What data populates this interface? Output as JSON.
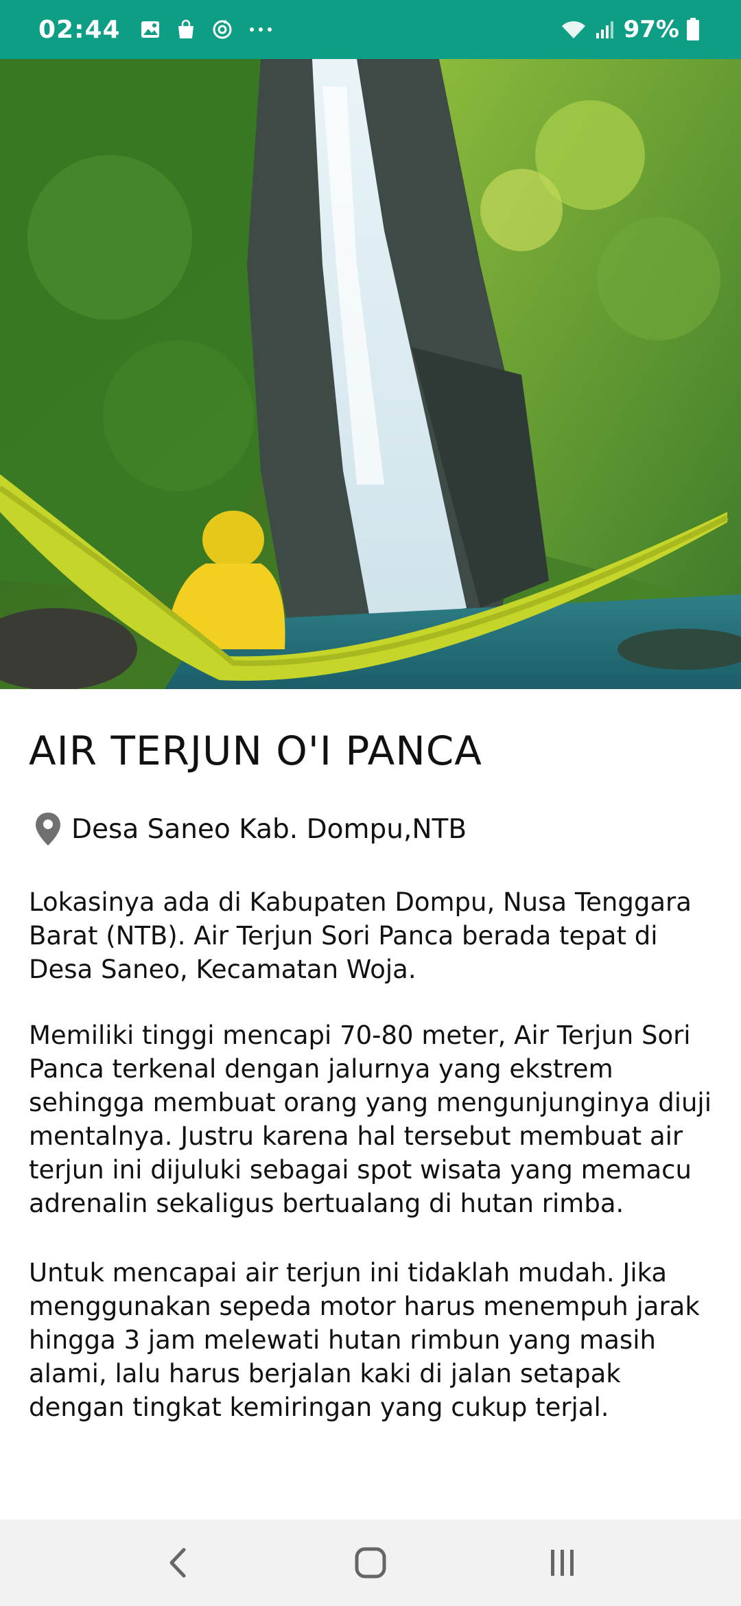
{
  "status_bar": {
    "time": "02:44",
    "battery": "97%",
    "icons_left": [
      "gallery-icon",
      "shopping-bag-icon",
      "sync-icon",
      "more-dots-icon"
    ],
    "icons_right": [
      "wifi-icon",
      "signal-icon",
      "battery-icon"
    ],
    "bg_color": "#0e9e86"
  },
  "hero": {
    "image_desc": "waterfall-hammock-photo"
  },
  "article": {
    "title": "AIR TERJUN O'I PANCA",
    "location": "Desa Saneo Kab. Dompu,NTB",
    "paragraphs": [
      "Lokasinya ada di Kabupaten Dompu, Nusa Tenggara Barat (NTB). Air Terjun Sori Panca berada tepat di Desa Saneo, Kecamatan Woja.",
      "Memiliki tinggi mencapi 70-80 meter, Air Terjun Sori Panca terkenal dengan jalurnya yang ekstrem sehingga membuat orang yang mengunjunginya diuji mentalnya. Justru karena hal tersebut membuat air terjun ini dijuluki sebagai spot wisata yang memacu adrenalin sekaligus bertualang di hutan rimba.",
      "Untuk mencapai air terjun ini tidaklah mudah. Jika menggunakan sepeda motor harus menempuh jarak hingga 3 jam melewati hutan rimbun yang masih alami, lalu harus berjalan kaki di jalan setapak dengan tingkat kemiringan yang cukup terjal."
    ]
  },
  "nav_bar": {
    "buttons": [
      "back-button",
      "home-button",
      "recents-button"
    ]
  }
}
